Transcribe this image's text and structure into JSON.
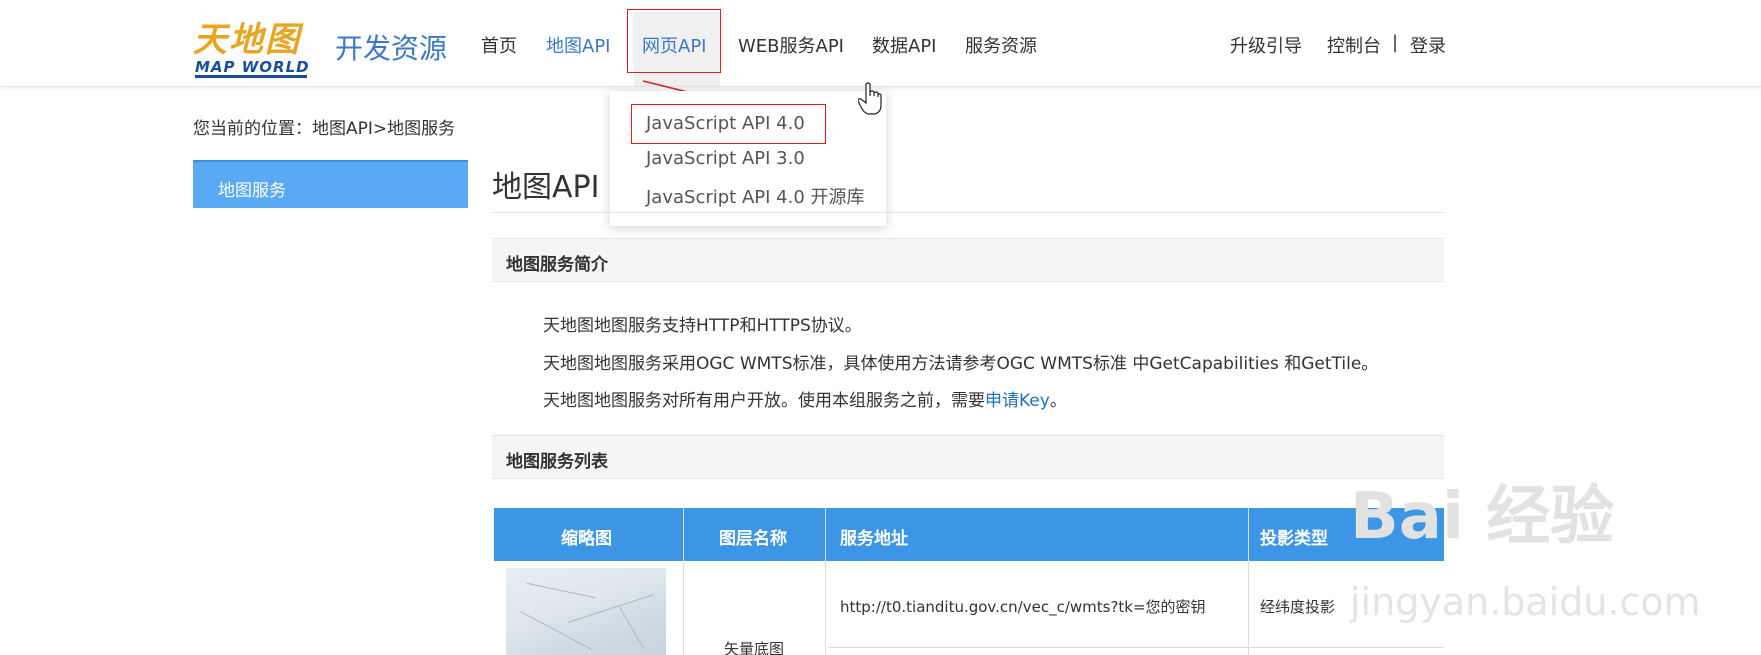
{
  "header": {
    "logo_cn": "天地图",
    "logo_en": "MAP WORLD",
    "brand_subtitle": "开发资源",
    "nav": [
      "首页",
      "地图API",
      "网页API",
      "WEB服务API",
      "数据API",
      "服务资源"
    ],
    "right": {
      "upgrade": "升级引导",
      "console": "控制台",
      "separator": "|",
      "login": "登录"
    }
  },
  "dropdown": {
    "items": [
      "JavaScript API 4.0",
      "JavaScript API 3.0",
      "JavaScript API 4.0 开源库"
    ]
  },
  "breadcrumb": "您当前的位置：地图API>地图服务",
  "sidebar": {
    "items": [
      "地图服务"
    ]
  },
  "main": {
    "title": "地图API",
    "section1": {
      "title": "地图服务简介",
      "line1": "天地图地图服务支持HTTP和HTTPS协议。",
      "line2": "天地图地图服务采用OGC WMTS标准，具体使用方法请参考OGC WMTS标准 中GetCapabilities 和GetTile。",
      "line3_prefix": "天地图地图服务对所有用户开放。使用本组服务之前，需要",
      "line3_link": "申请Key",
      "line3_suffix": "。"
    },
    "section2": {
      "title": "地图服务列表",
      "headers": [
        "缩略图",
        "图层名称",
        "服务地址",
        "投影类型"
      ],
      "row1": {
        "layer": "矢量底图",
        "url": "http://t0.tianditu.gov.cn/vec_c/wmts?tk=您的密钥",
        "projection": "经纬度投影"
      }
    }
  },
  "watermark": {
    "main": "Bai 经验",
    "sub": "jingyan.baidu.com"
  },
  "colors": {
    "accent": "#3b79c8",
    "sidebar_active": "#5aa9f5",
    "table_header": "#3d95e6",
    "highlight_box": "#e02020"
  }
}
